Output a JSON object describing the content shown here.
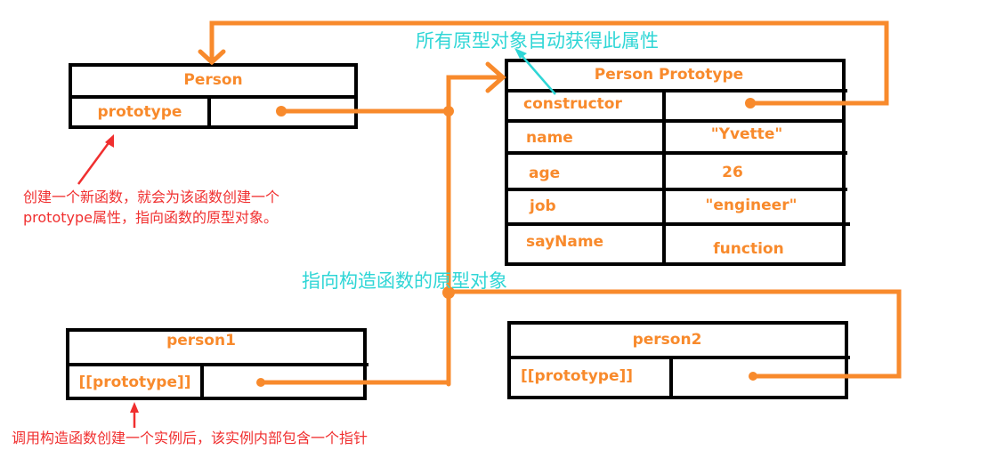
{
  "colors": {
    "pointer": "#f88a2c",
    "border": "#000000",
    "label": "#f88a2c",
    "annotation_cyan": "#2fd6d6",
    "annotation_red": "#f02f2f"
  },
  "person": {
    "title": "Person",
    "rows": [
      {
        "key": "prototype",
        "value": ""
      }
    ]
  },
  "prototype_obj": {
    "title": "Person Prototype",
    "rows": [
      {
        "key": "constructor",
        "value": ""
      },
      {
        "key": "name",
        "value": "\"Yvette\""
      },
      {
        "key": "age",
        "value": "26"
      },
      {
        "key": "job",
        "value": "\"engineer\""
      },
      {
        "key": "sayName",
        "value": "function"
      }
    ]
  },
  "person1": {
    "title": "person1",
    "rows": [
      {
        "key": "[[prototype]]",
        "value": ""
      }
    ]
  },
  "person2": {
    "title": "person2",
    "rows": [
      {
        "key": "[[prototype]]",
        "value": ""
      }
    ]
  },
  "annotations": {
    "constructor_note": "所有原型对象自动获得此属性",
    "instance_pointer_note": "指向构造函数的原型对象",
    "prototype_note_line1": "创建一个新函数，就会为该函数创建一个",
    "prototype_note_line2_prefix": "prototype",
    "prototype_note_line2_suffix": "属性，指向函数的原型对象。",
    "instance_note": "调用构造函数创建一个实例后，该实例内部包含一个指针"
  },
  "edges": [
    {
      "from": "person.prototype",
      "to": "prototype_obj",
      "label": ""
    },
    {
      "from": "prototype_obj.constructor",
      "to": "person",
      "label": ""
    },
    {
      "from": "person1.[[prototype]]",
      "to": "prototype_obj",
      "label": "指向构造函数的原型对象"
    },
    {
      "from": "person2.[[prototype]]",
      "to": "prototype_obj",
      "label": "指向构造函数的原型对象"
    }
  ]
}
